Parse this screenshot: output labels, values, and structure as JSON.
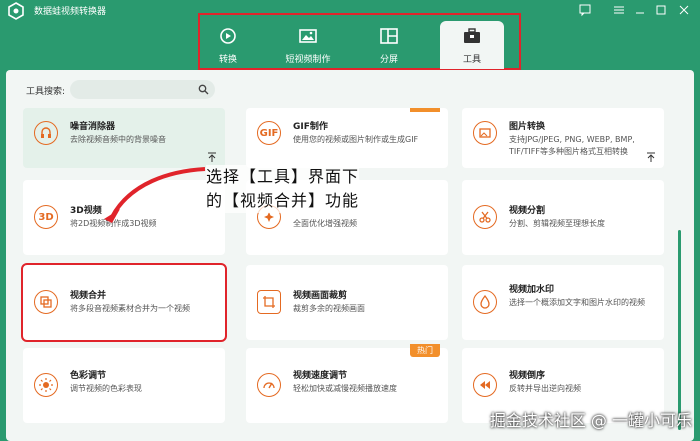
{
  "app": {
    "title": "数据蛙视频转换器"
  },
  "nav": {
    "tabs": [
      {
        "label": "转换",
        "icon": "convert-icon"
      },
      {
        "label": "短视频制作",
        "icon": "image-icon"
      },
      {
        "label": "分屏",
        "icon": "split-screen-icon"
      },
      {
        "label": "工具",
        "icon": "toolbox-icon"
      }
    ],
    "active": "工具"
  },
  "search": {
    "label": "工具搜索:",
    "value": "",
    "placeholder": ""
  },
  "tools": [
    {
      "title": "噪音消除器",
      "desc": "去除视频音频中的背景噪音",
      "icon": "noise-icon"
    },
    {
      "title": "GIF制作",
      "desc": "使用您的视频或图片制作或生成GIF",
      "icon": "gif-icon",
      "icon_text": "GIF"
    },
    {
      "title": "图片转换",
      "desc": "支持JPG/JPEG, PNG, WEBP, BMP, TIF/TIFF等多种图片格式互相转换",
      "icon": "image-convert-icon"
    },
    {
      "title": "3D视频",
      "desc": "将2D视频制作成3D视频",
      "icon": "3d-icon",
      "icon_text": "3D"
    },
    {
      "title": "",
      "desc": "全面优化增强视频",
      "icon": "enhance-icon"
    },
    {
      "title": "视频分割",
      "desc": "分割、剪辑视频至理想长度",
      "icon": "scissors-icon"
    },
    {
      "title": "视频合并",
      "desc": "将多段音视频素材合并为一个视频",
      "icon": "merge-icon"
    },
    {
      "title": "视频画面裁剪",
      "desc": "裁剪多余的视频画面",
      "icon": "crop-icon"
    },
    {
      "title": "视频加水印",
      "desc": "选择一个概添加文字和图片水印的视频",
      "icon": "watermark-icon"
    },
    {
      "title": "色彩调节",
      "desc": "调节视频的色彩表现",
      "icon": "color-icon"
    },
    {
      "title": "视频速度调节",
      "desc": "轻松加快或减慢视频播放速度",
      "icon": "speed-icon",
      "badge": "热门"
    },
    {
      "title": "视频倒序",
      "desc": "反转并导出逆向视频",
      "icon": "reverse-icon"
    }
  ],
  "annotation": {
    "line1": "选择【工具】界面下",
    "line2": "的【视频合并】功能"
  },
  "watermark": "掘金技术社区 @ 一罐小可乐",
  "colors": {
    "brand": "#2a9a6f",
    "accent": "#e46a22",
    "highlight": "#e0242b",
    "hot": "#f28f2b"
  }
}
